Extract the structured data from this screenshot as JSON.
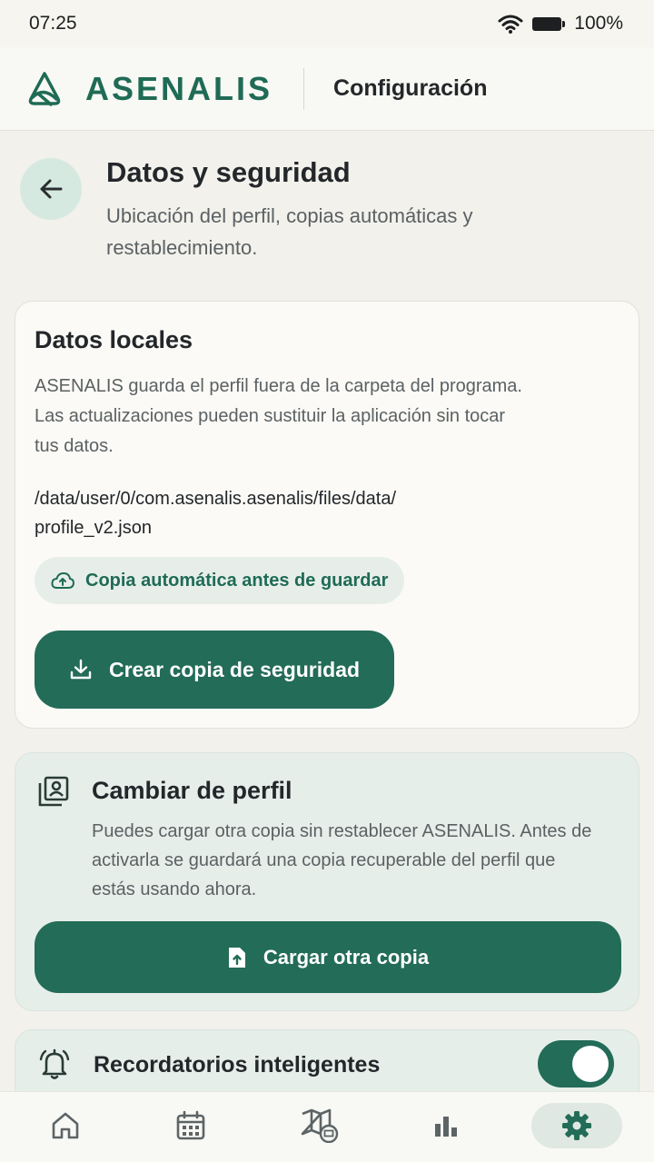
{
  "status_bar": {
    "time": "07:25",
    "battery": "100%",
    "icons": [
      "wifi-icon",
      "battery-icon"
    ]
  },
  "header": {
    "brand": "ASENALIS",
    "section": "Configuración"
  },
  "page": {
    "title": "Datos y seguridad",
    "subtitle": "Ubicación del perfil, copias automáticas y restablecimiento."
  },
  "local_data": {
    "title": "Datos locales",
    "description": "ASENALIS guarda el perfil fuera de la carpeta del programa. Las actualizaciones pueden sustituir la aplicación sin tocar tus datos.",
    "path_line1": "/data/user/0/com.asenalis.asenalis/files/data/",
    "path_line2": "profile_v2.json",
    "chip_label": "Copia automática antes de guardar",
    "backup_button": "Crear copia de seguridad"
  },
  "switch_profile": {
    "title": "Cambiar de perfil",
    "description": "Puedes cargar otra copia sin restablecer ASENALIS. Antes de activarla se guardará una copia recuperable del perfil que estás usando ahora.",
    "load_button": "Cargar otra copia"
  },
  "reminders": {
    "title": "Recordatorios inteligentes",
    "enabled": true
  },
  "bottom_nav": {
    "items": [
      "home-icon",
      "calendar-icon",
      "map-icon",
      "stats-icon",
      "settings-icon"
    ],
    "active": "settings-icon"
  },
  "colors": {
    "accent": "#236c57",
    "brand": "#1f6b55",
    "background": "#f2f1ec"
  }
}
